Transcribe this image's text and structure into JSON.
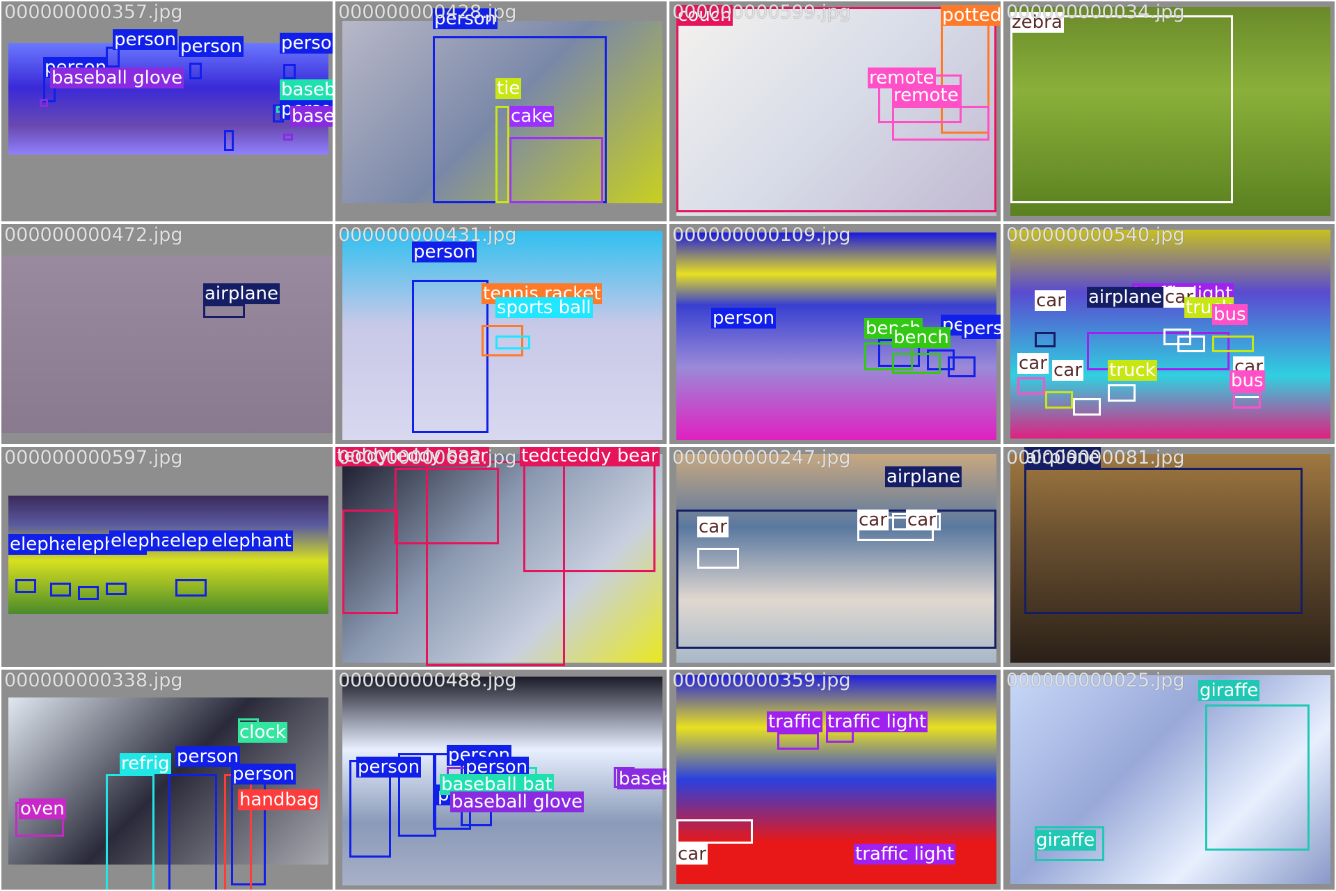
{
  "colors": {
    "person": "#1020e8",
    "baseball glove": "#8a2be2",
    "baseball bat": "#20e0b0",
    "cake": "#9b30ff",
    "tie": "#c8e614",
    "couch": "#e6145a",
    "potted plant": "#ff7a28",
    "remote": "#ff50c8",
    "zebra": "#ffffff",
    "airplane": "#151e64",
    "tennis racket": "#ff7a28",
    "sports ball": "#20e6ff",
    "bench": "#32c814",
    "traffic light": "#a020f0",
    "car": "#ffffff",
    "truck": "#c8e614",
    "bus": "#ff50c8",
    "elephant": "#1020e8",
    "teddy bear": "#e6145a",
    "clock": "#32e6a0",
    "refrigerator": "#20e6e6",
    "handbag": "#ff3c3c",
    "oven": "#c828c8",
    "giraffe": "#20c8b4"
  },
  "tiles": [
    {
      "filename": "000000000357.jpg",
      "bg": "linear-gradient(180deg,#6a78ff 0%,#3a2ad8 40%,#6a4ab0 75%,#9080ff 100%)",
      "labels": [
        [
          "person",
          "person"
        ],
        [
          "person",
          "person"
        ],
        [
          "person",
          "person"
        ],
        [
          "person",
          "person"
        ],
        [
          "person",
          "person"
        ],
        [
          "person",
          "person"
        ],
        [
          "baseball glove",
          "baseball glove"
        ],
        [
          "baseball bat",
          "baseball bat"
        ],
        [
          "baseball glove",
          "baseball glove"
        ]
      ]
    },
    {
      "filename": "000000000428.jpg",
      "bg": "linear-gradient(135deg,#b8b8c8 0%,#7a88a8 50%,#c8d020 100%)",
      "labels": [
        [
          "person",
          "person"
        ],
        [
          "tie",
          "tie"
        ],
        [
          "cake",
          "cake"
        ]
      ]
    },
    {
      "filename": "000000000599.jpg",
      "bg": "linear-gradient(135deg,#f4f2ee 0%,#d8dce8 50%,#c0b8d0 100%)",
      "labels": [
        [
          "couch",
          "couch"
        ],
        [
          "potted plant",
          "potted"
        ],
        [
          "remote",
          "remote"
        ],
        [
          "remote",
          "remote"
        ]
      ]
    },
    {
      "filename": "000000000034.jpg",
      "bg": "linear-gradient(180deg,#6a8a2a 0%,#8ab03a 40%,#5a8020 100%)",
      "labels": [
        [
          "zebra",
          "zebra"
        ]
      ]
    },
    {
      "filename": "000000000472.jpg",
      "bg": "linear-gradient(180deg,#9a8aa0 0%,#8a7a90 100%)",
      "labels": [
        [
          "airplane",
          "airplane"
        ]
      ]
    },
    {
      "filename": "000000000431.jpg",
      "bg": "linear-gradient(180deg,#30c0f0 0%,#c8c8e8 45%,#d8d8f0 100%)",
      "labels": [
        [
          "person",
          "person"
        ],
        [
          "tennis racket",
          "tennis racket"
        ],
        [
          "sports ball",
          "sports ball"
        ]
      ]
    },
    {
      "filename": "000000000109.jpg",
      "bg": "linear-gradient(180deg,#1818e0 0%,#e8e020 20%,#3840d0 35%,#9a8ad8 65%,#e020c0 100%)",
      "labels": [
        [
          "person",
          "person"
        ],
        [
          "person",
          "person"
        ],
        [
          "person",
          "person"
        ],
        [
          "bench",
          "bench"
        ],
        [
          "bench",
          "bench"
        ]
      ]
    },
    {
      "filename": "000000000540.jpg",
      "bg": "linear-gradient(180deg,#c8c020 0%,#5a4ad0 30%,#30d0e0 70%,#e02080 100%)",
      "labels": [
        [
          "traffic light",
          "traffic light"
        ],
        [
          "airplane",
          "airplane"
        ],
        [
          "car",
          "car"
        ],
        [
          "car",
          "car"
        ],
        [
          "truck",
          "truck"
        ],
        [
          "bus",
          "bus"
        ],
        [
          "car",
          "car"
        ],
        [
          "car",
          "car"
        ],
        [
          "truck",
          "truck"
        ],
        [
          "car",
          "car"
        ],
        [
          "bus",
          "bus"
        ]
      ]
    },
    {
      "filename": "000000000597.jpg",
      "bg": "linear-gradient(180deg,#3a2a5a 0%,#5a5aa0 25%,#d8e020 55%,#4a8a2a 100%)",
      "labels": [
        [
          "elephant",
          "elephant"
        ],
        [
          "elephant",
          "elephant"
        ],
        [
          "elephant",
          "elephant"
        ],
        [
          "elephant",
          "elephant"
        ],
        [
          "elephant",
          "elephant"
        ]
      ]
    },
    {
      "filename": "000000000632.jpg",
      "bg": "linear-gradient(135deg,#1a1a2a 0%,#8a98b0 40%,#c8d0e0 70%,#e8e820 100%)",
      "labels": [
        [
          "teddy bear",
          "teddy"
        ],
        [
          "teddy bear",
          "teddy bear"
        ],
        [
          "teddy bear",
          "teddy bear"
        ],
        [
          "teddy bear",
          "teddy bear"
        ]
      ]
    },
    {
      "filename": "000000000247.jpg",
      "bg": "linear-gradient(180deg,#c8a880 0%,#5a78a0 35%,#e0d8d0 70%,#a8b8c8 100%)",
      "labels": [
        [
          "airplane",
          "airplane"
        ],
        [
          "car",
          "car"
        ],
        [
          "car",
          "car"
        ],
        [
          "car",
          "car"
        ]
      ]
    },
    {
      "filename": "000000000081.jpg",
      "bg": "linear-gradient(180deg,#a07840 0%,#6a5030 40%,#2a2018 100%)",
      "labels": [
        [
          "airplane",
          "airplane"
        ]
      ]
    },
    {
      "filename": "000000000338.jpg",
      "bg": "linear-gradient(135deg,#e0e8f0 0%,#2a2a3a 50%,#a8a8b0 100%)",
      "labels": [
        [
          "clock",
          "clock"
        ],
        [
          "refrigerator",
          "refrig"
        ],
        [
          "person",
          "person"
        ],
        [
          "person",
          "person"
        ],
        [
          "handbag",
          "handbag"
        ],
        [
          "oven",
          "oven"
        ]
      ]
    },
    {
      "filename": "000000000488.jpg",
      "bg": "linear-gradient(180deg,#1a1a28 0%,#e8f0ff 35%,#8a9ab8 70%,#a8b0c8 100%)",
      "labels": [
        [
          "person",
          "person"
        ],
        [
          "person",
          "person"
        ],
        [
          "person",
          "person"
        ],
        [
          "person",
          "person"
        ],
        [
          "baseball bat",
          "baseball bat"
        ],
        [
          "baseball glove",
          "baseball glove"
        ],
        [
          "baseball glove",
          "baseball glove"
        ]
      ]
    },
    {
      "filename": "000000000359.jpg",
      "bg": "linear-gradient(180deg,#2020e0 0%,#e8e020 25%,#2a40e0 50%,#e81818 80%,#e81818 100%)",
      "labels": [
        [
          "traffic light",
          "traffic"
        ],
        [
          "traffic light",
          "traffic light"
        ],
        [
          "traffic light",
          "traffic light"
        ],
        [
          "car",
          "car"
        ]
      ]
    },
    {
      "filename": "000000000025.jpg",
      "bg": "linear-gradient(135deg,#c8d8f8 0%,#98a8d8 40%,#e8f0ff 70%,#8898c8 100%)",
      "labels": [
        [
          "giraffe",
          "giraffe"
        ],
        [
          "giraffe",
          "giraffe"
        ]
      ]
    }
  ]
}
